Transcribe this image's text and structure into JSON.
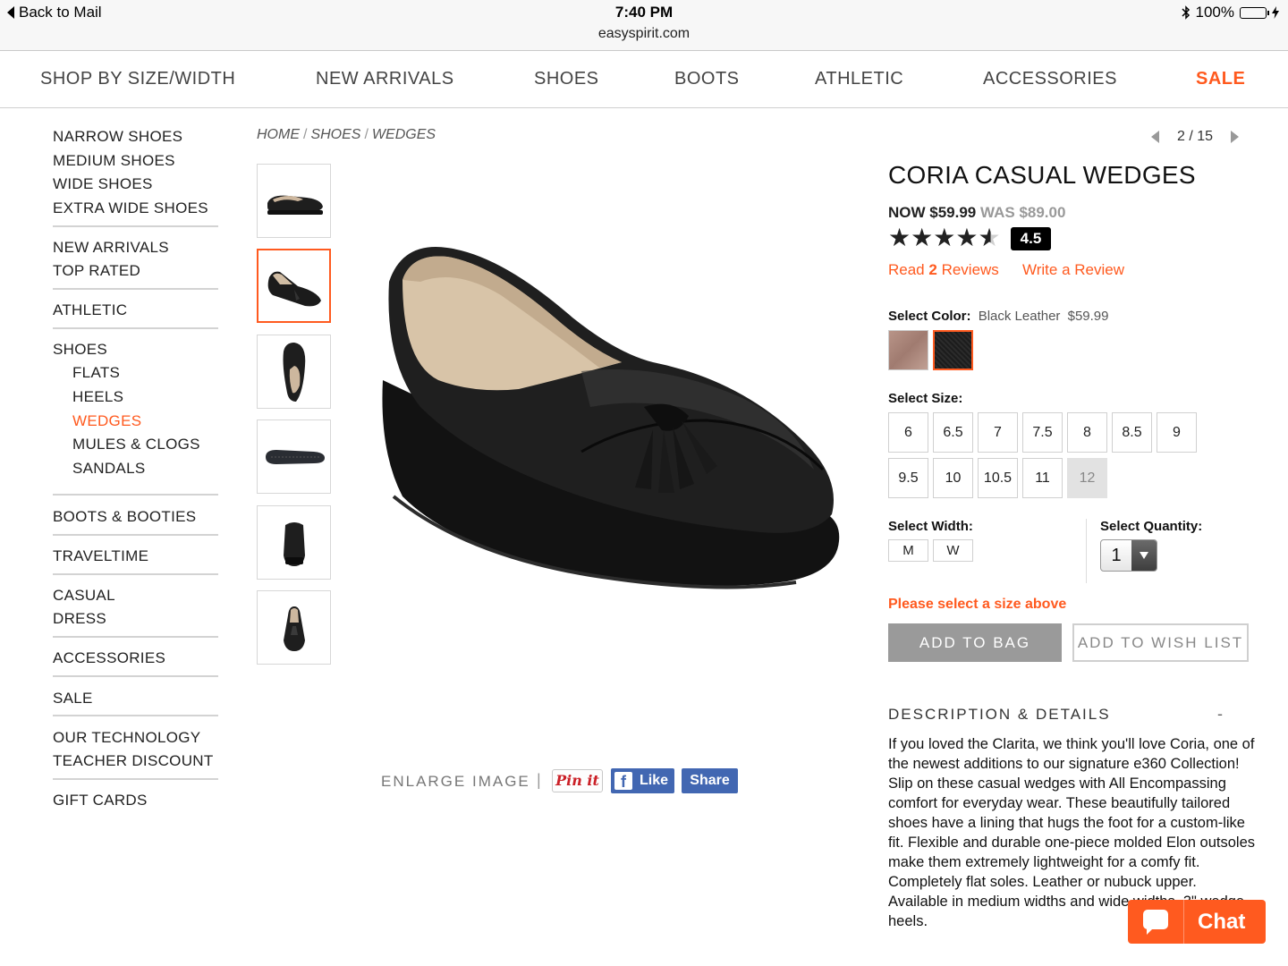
{
  "status_bar": {
    "back_label": "Back to Mail",
    "time": "7:40 PM",
    "url": "easyspirit.com",
    "battery": "100%"
  },
  "top_nav": [
    {
      "label": "SHOP BY SIZE/WIDTH"
    },
    {
      "label": "NEW ARRIVALS"
    },
    {
      "label": "SHOES"
    },
    {
      "label": "BOOTS"
    },
    {
      "label": "ATHLETIC"
    },
    {
      "label": "ACCESSORIES"
    },
    {
      "label": "SALE"
    }
  ],
  "sidebar": {
    "groups": [
      [
        "NARROW SHOES",
        "MEDIUM SHOES",
        "WIDE SHOES",
        "EXTRA WIDE SHOES"
      ],
      [
        "NEW ARRIVALS",
        "TOP RATED"
      ],
      [
        "ATHLETIC"
      ],
      [
        "SHOES"
      ],
      [
        "BOOTS & BOOTIES"
      ],
      [
        "TRAVELTIME"
      ],
      [
        "CASUAL",
        "DRESS"
      ],
      [
        "ACCESSORIES"
      ],
      [
        "SALE"
      ],
      [
        "OUR TECHNOLOGY",
        "TEACHER DISCOUNT"
      ],
      [
        "GIFT CARDS"
      ]
    ],
    "shoes_sub": [
      "FLATS",
      "HEELS",
      "WEDGES",
      "MULES & CLOGS",
      "SANDALS"
    ],
    "active_sub": "WEDGES"
  },
  "breadcrumb": [
    "HOME",
    "SHOES",
    "WEDGES"
  ],
  "breadcrumb_sep": "/",
  "pager": {
    "text": "2 / 15"
  },
  "gallery": {
    "enlarge_label": "ENLARGE IMAGE",
    "pin_label": "Pin it",
    "like_label": "Like",
    "share_label": "Share"
  },
  "product": {
    "title": "CORIA CASUAL WEDGES",
    "now_label": "NOW $59.99",
    "was_label": "WAS $89.00",
    "rating_value": 4.5,
    "rating_label": "4.5",
    "reviews_pre": "Read ",
    "reviews_count": "2",
    "reviews_post": " Reviews",
    "write_review": "Write a Review",
    "select_color_label": "Select Color:",
    "selected_color": "Black Leather",
    "selected_color_price": "$59.99",
    "colors": [
      {
        "name": "taupe",
        "hex": "#a8847a"
      },
      {
        "name": "black",
        "hex": "#222222"
      }
    ],
    "select_size_label": "Select Size:",
    "sizes_row1": [
      "6",
      "6.5",
      "7",
      "7.5",
      "8",
      "8.5",
      "9"
    ],
    "sizes_row2": [
      "9.5",
      "10",
      "10.5",
      "11",
      "12"
    ],
    "unavailable_size": "12",
    "select_width_label": "Select Width:",
    "widths": [
      "M",
      "W"
    ],
    "select_quantity_label": "Select Quantity:",
    "quantity": "1",
    "warning": "Please select a size above",
    "add_to_bag": "ADD TO BAG",
    "add_to_wish": "ADD TO WISH LIST",
    "desc_title": "DESCRIPTION & DETAILS",
    "desc_toggle": "-",
    "description": "If you loved the Clarita, we think you'll love Coria, one of the newest additions to our signature e360 Collection! Slip on these casual wedges with All Encompassing comfort for everyday wear. These beautifully tailored shoes have a lining that hugs the foot for a custom-like fit. Flexible and durable one-piece molded Elon outsoles make them extremely lightweight for a comfy fit. Completely flat soles. Leather or nubuck upper. Available in medium widths and wide widths. 3\" wedge heels."
  },
  "chat": {
    "label": "Chat"
  },
  "colors": {
    "accent": "#ff5a1f",
    "facebook": "#4267b2"
  }
}
